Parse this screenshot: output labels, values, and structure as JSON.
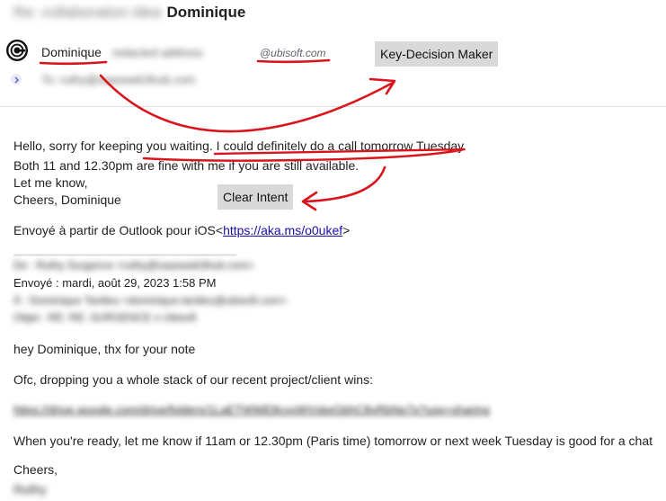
{
  "header": {
    "subject_blurred": "Re: collaboration idea",
    "subject_name": "Dominique"
  },
  "sender": {
    "name": "Dominique",
    "email_blurred": "redacted address",
    "domain": "@ubisoft.com",
    "to_blurred": "To: ruthy@saasweb3hub.com"
  },
  "tags": {
    "key_decision_maker": "Key-Decision Maker",
    "clear_intent": "Clear Intent"
  },
  "body": {
    "line1_a": "Hello, sorry for keeping you waiting. ",
    "line1_b": "I could definitely do a call tomorrow Tuesday.",
    "line2": "Both 11 and 12.30pm are fine with me if you are still available.",
    "line3": "Let me know,",
    "line4": "Cheers, Dominique",
    "sent_from_prefix": "Envoyé à partir de Outlook pour iOS<",
    "sent_from_link": "https://aka.ms/o0ukef",
    "sent_from_suffix": ">"
  },
  "quoted": {
    "de_blurred": "De : Ruthy Surgence <ruthy@saasweb3hub.com>",
    "envoye": "Envoyé : mardi, août 29, 2023 1:58 PM",
    "a_blurred": "À : Dominique Tardieu <dominique.tardieu@ubisoft.com>",
    "objet_blurred": "Objet : RE: RE: SURGENCE x Ubisoft",
    "greeting": "hey Dominique, thx for your note",
    "stack": "Ofc, dropping you a whole stack of our recent project/client wins:",
    "drive_link_blurred": "https://drive.google.com/drive/folders/1LaETWWE8cvoWVskeGbhC8vRbNp7p?usp=sharing",
    "ready": "When you're ready, let me know if 11am or 12.30pm (Paris time) tomorrow or next week Tuesday is good for a chat",
    "cheers": "Cheers,",
    "signature_blurred": "Ruthy"
  },
  "colors": {
    "annotation": "#d9141c",
    "link": "#1a0dab",
    "tag_bg": "#d9d9d9"
  }
}
